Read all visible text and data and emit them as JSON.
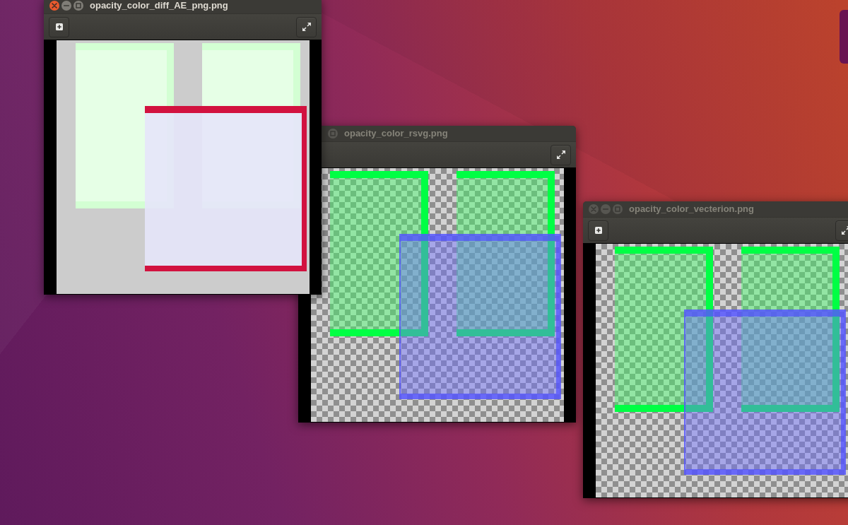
{
  "windows": [
    {
      "title": "opacity_color_diff_AE_png.png",
      "focused": true,
      "kind": "diff",
      "controls": [
        {
          "kind": "close"
        },
        {
          "kind": "minimize"
        },
        {
          "kind": "maximize"
        }
      ],
      "tools": [
        {
          "kind": "add"
        },
        {
          "kind": "fullscreen"
        }
      ]
    },
    {
      "title": "opacity_color_rsvg.png",
      "focused": false,
      "kind": "render",
      "controls": [
        {
          "kind": "maximize"
        }
      ],
      "tools": [
        {
          "kind": "fullscreen"
        }
      ]
    },
    {
      "title": "opacity_color_vecterion.png",
      "focused": false,
      "kind": "render",
      "controls": [
        {
          "kind": "close"
        },
        {
          "kind": "minimize"
        },
        {
          "kind": "maximize"
        }
      ],
      "tools": [
        {
          "kind": "add"
        },
        {
          "kind": "fullscreen"
        }
      ]
    }
  ]
}
